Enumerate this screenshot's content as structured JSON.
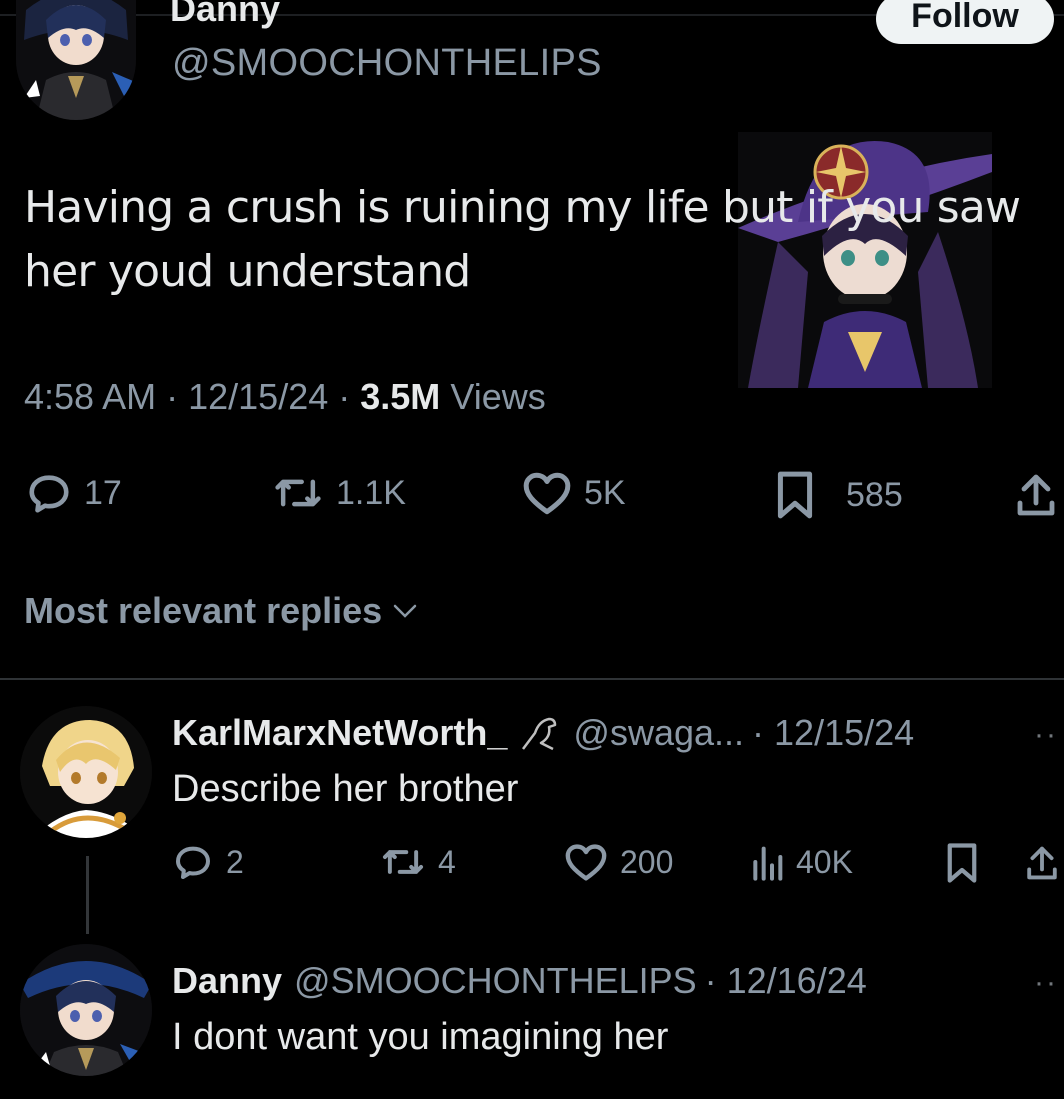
{
  "main_tweet": {
    "display_name": "Danny",
    "handle": "@SMOOCHONTHELIPS",
    "follow_label": "Follow",
    "text_line1": "Having a crush is ruining my life but if you saw",
    "text_line2": "her youd understand",
    "time": "4:58 AM",
    "date": "12/15/24",
    "views_count": "3.5M",
    "views_label": "Views",
    "stats": {
      "replies": "17",
      "retweets": "1.1K",
      "likes": "5K",
      "bookmarks": "585"
    }
  },
  "replies_filter": "Most relevant replies",
  "replies": [
    {
      "display_name": "KarlMarxNetWorth_",
      "handle": "@swaga...",
      "date": "· 12/15/24",
      "text": "Describe her brother",
      "stats": {
        "replies": "2",
        "retweets": "4",
        "likes": "200",
        "views": "40K"
      }
    },
    {
      "display_name": "Danny",
      "handle": "@SMOOCHONTHELIPS",
      "date": "· 12/16/24",
      "text": "I dont want you imagining her"
    }
  ],
  "colors": {
    "background": "#000000",
    "text": "#e7e9ea",
    "muted": "#8b98a5",
    "divider": "#2f3336"
  }
}
